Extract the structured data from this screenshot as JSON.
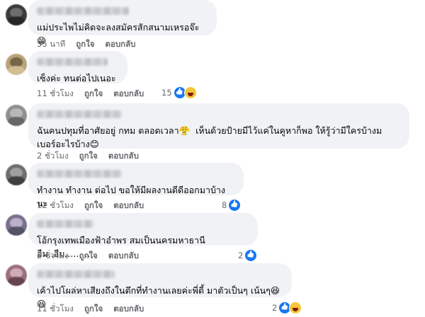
{
  "comments": [
    {
      "text": "แม่ประไพไม่คิดจะลงสมัครสักสนามเหรอจ๊ะ 😁",
      "time": "55 นาที",
      "like": "ถูกใจ",
      "reply": "ตอบกลับ",
      "reactions": ""
    },
    {
      "text": "เซ็งค่ะ ทนต่อไปเนอะ",
      "time": "11 ชั่วโมง",
      "like": "ถูกใจ",
      "reply": "ตอบกลับ",
      "reactions": "15"
    },
    {
      "text": "ฉันคนปทุมที่อาศัยอยู่ กทม ตลอดเวลา😤  เห็นด้วยป้ายมีไว้แค่ในคูหาก็พอ ให้รู้ว่ามีใครบ้างมเบอร์อะไรบ้าง😊",
      "time": "2 ชั่วโมง",
      "like": "ถูกใจ",
      "reply": "ตอบกลับ",
      "reactions": ""
    },
    {
      "text": "ทำงาน ทำงาน ต่อไป ขอให้มีผลงานดีดีออกมาบ้างนะ",
      "time": "12 ชั่วโมง",
      "like": "ถูกใจ",
      "reply": "ตอบกลับ",
      "reactions": "8"
    },
    {
      "text": "โอ้กรุงเทพเมืองฟ้าอำพร สมเป็นนครมหาธานี อืม..อืม.........",
      "time": "2 ชั่วโมง",
      "like": "ถูกใจ",
      "reply": "ตอบกลับ",
      "reactions": "2"
    },
    {
      "text": "เค้าไปโผล่หาเสียงถึงในตึกที่ทำงานเลยค่ะพี่ตี้ มาตัวเป็นๆ เน้นๆ😆😆",
      "time": "11 ชั่วโมง",
      "like": "ถูกใจ",
      "reply": "ตอบกลับ",
      "reactions": "2"
    }
  ],
  "colors": {
    "bubble": "#f0f2f5",
    "meta_text": "#65676b",
    "like_blue": "#1877f2",
    "haha_yellow": "#f7c53a"
  }
}
